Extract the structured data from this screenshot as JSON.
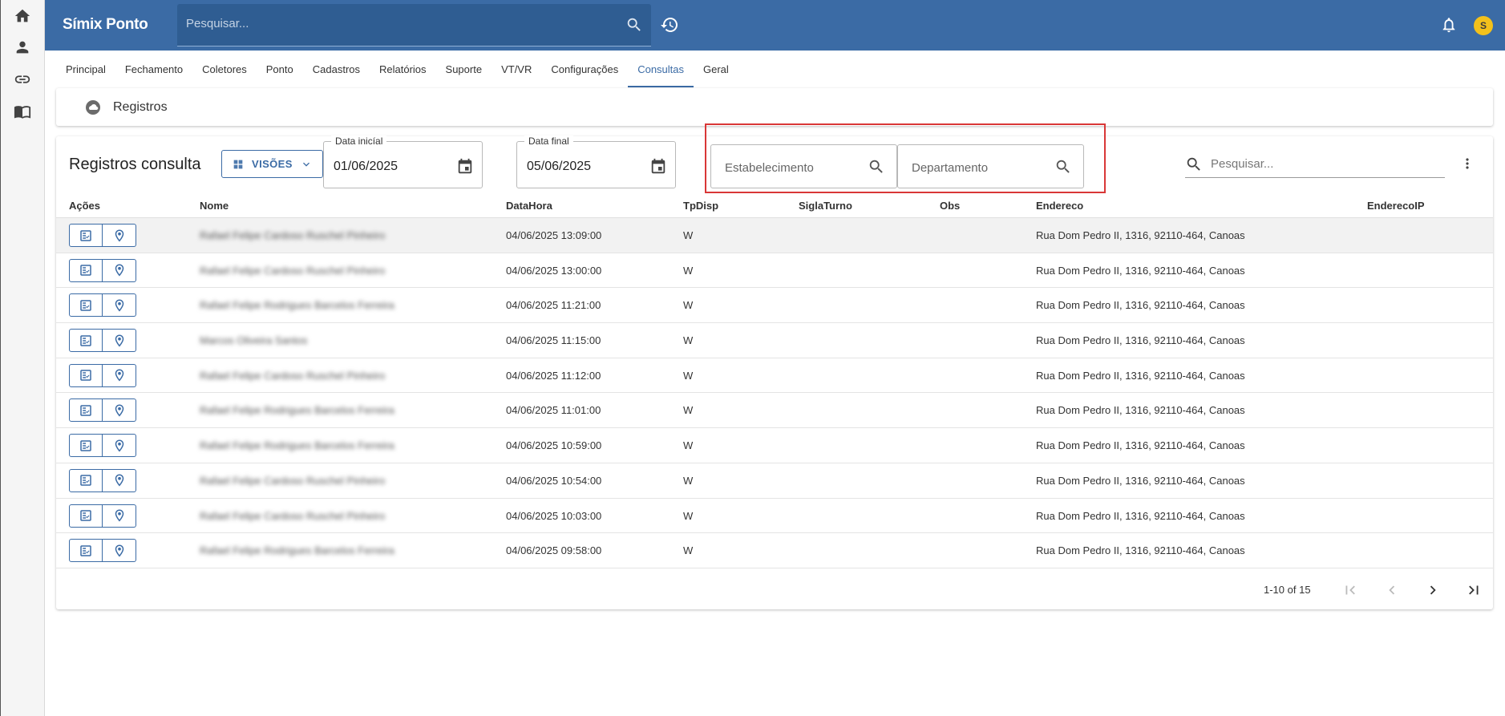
{
  "app": {
    "title": "Símix Ponto",
    "avatar_initial": "S"
  },
  "top_search": {
    "placeholder": "Pesquisar..."
  },
  "left_rail": [
    "home-icon",
    "person-icon",
    "link-icon",
    "book-icon"
  ],
  "nav_tabs": [
    {
      "label": "Principal",
      "active": false
    },
    {
      "label": "Fechamento",
      "active": false
    },
    {
      "label": "Coletores",
      "active": false
    },
    {
      "label": "Ponto",
      "active": false
    },
    {
      "label": "Cadastros",
      "active": false
    },
    {
      "label": "Relatórios",
      "active": false
    },
    {
      "label": "Suporte",
      "active": false
    },
    {
      "label": "VT/VR",
      "active": false
    },
    {
      "label": "Configurações",
      "active": false
    },
    {
      "label": "Consultas",
      "active": true
    },
    {
      "label": "Geral",
      "active": false
    }
  ],
  "breadcrumb": {
    "label": "Registros"
  },
  "card": {
    "title": "Registros consulta",
    "visoes_label": "VISÕES",
    "date_start": {
      "legend": "Data inicíal",
      "value": "01/06/2025"
    },
    "date_end": {
      "legend": "Data final",
      "value": "05/06/2025"
    },
    "estabelecimento": {
      "placeholder": "Estabelecimento"
    },
    "departamento": {
      "placeholder": "Departamento"
    },
    "search": {
      "placeholder": "Pesquisar..."
    }
  },
  "table": {
    "columns": [
      "Ações",
      "Nome",
      "DataHora",
      "TpDisp",
      "SiglaTurno",
      "Obs",
      "Endereco",
      "EnderecoIP"
    ],
    "rows": [
      {
        "nome": "Rafael Felipe Cardoso Ruschel Pinheiro",
        "datahora": "04/06/2025 13:09:00",
        "tpdisp": "W",
        "siglaturno": "",
        "obs": "",
        "endereco": "Rua Dom Pedro II, 1316, 92110-464, Canoas",
        "enderecoip": ""
      },
      {
        "nome": "Rafael Felipe Cardoso Ruschel Pinheiro",
        "datahora": "04/06/2025 13:00:00",
        "tpdisp": "W",
        "siglaturno": "",
        "obs": "",
        "endereco": "Rua Dom Pedro II, 1316, 92110-464, Canoas",
        "enderecoip": ""
      },
      {
        "nome": "Rafael Felipe Rodrigues Barcelos Ferreira",
        "datahora": "04/06/2025 11:21:00",
        "tpdisp": "W",
        "siglaturno": "",
        "obs": "",
        "endereco": "Rua Dom Pedro II, 1316, 92110-464, Canoas",
        "enderecoip": ""
      },
      {
        "nome": "Marcos Oliveira Santos",
        "datahora": "04/06/2025 11:15:00",
        "tpdisp": "W",
        "siglaturno": "",
        "obs": "",
        "endereco": "Rua Dom Pedro II, 1316, 92110-464, Canoas",
        "enderecoip": ""
      },
      {
        "nome": "Rafael Felipe Cardoso Ruschel Pinheiro",
        "datahora": "04/06/2025 11:12:00",
        "tpdisp": "W",
        "siglaturno": "",
        "obs": "",
        "endereco": "Rua Dom Pedro II, 1316, 92110-464, Canoas",
        "enderecoip": ""
      },
      {
        "nome": "Rafael Felipe Rodrigues Barcelos Ferreira",
        "datahora": "04/06/2025 11:01:00",
        "tpdisp": "W",
        "siglaturno": "",
        "obs": "",
        "endereco": "Rua Dom Pedro II, 1316, 92110-464, Canoas",
        "enderecoip": ""
      },
      {
        "nome": "Rafael Felipe Rodrigues Barcelos Ferreira",
        "datahora": "04/06/2025 10:59:00",
        "tpdisp": "W",
        "siglaturno": "",
        "obs": "",
        "endereco": "Rua Dom Pedro II, 1316, 92110-464, Canoas",
        "enderecoip": ""
      },
      {
        "nome": "Rafael Felipe Cardoso Ruschel Pinheiro",
        "datahora": "04/06/2025 10:54:00",
        "tpdisp": "W",
        "siglaturno": "",
        "obs": "",
        "endereco": "Rua Dom Pedro II, 1316, 92110-464, Canoas",
        "enderecoip": ""
      },
      {
        "nome": "Rafael Felipe Cardoso Ruschel Pinheiro",
        "datahora": "04/06/2025 10:03:00",
        "tpdisp": "W",
        "siglaturno": "",
        "obs": "",
        "endereco": "Rua Dom Pedro II, 1316, 92110-464, Canoas",
        "enderecoip": ""
      },
      {
        "nome": "Rafael Felipe Rodrigues Barcelos Ferreira",
        "datahora": "04/06/2025 09:58:00",
        "tpdisp": "W",
        "siglaturno": "",
        "obs": "",
        "endereco": "Rua Dom Pedro II, 1316, 92110-464, Canoas",
        "enderecoip": ""
      }
    ]
  },
  "pagination": {
    "text": "1-10 of 15"
  },
  "colors": {
    "primary": "#3b6ba5",
    "highlight": "#d93737",
    "avatar": "#f3c11b"
  }
}
